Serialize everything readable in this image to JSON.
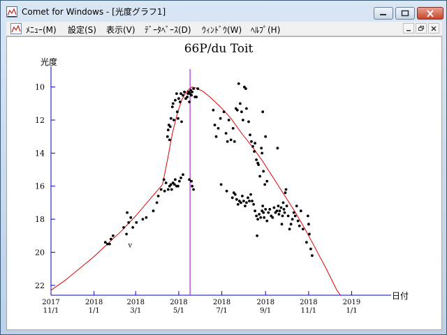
{
  "window": {
    "title": "Comet for Windows - [光度グラフ1]",
    "controls": {
      "minimize": "minimize",
      "maximize": "maximize",
      "close": "close"
    }
  },
  "menu": {
    "items": [
      {
        "label": "ﾒﾆｭｰ(M)"
      },
      {
        "label": "設定(S)"
      },
      {
        "label": "表示(V)"
      },
      {
        "label": "ﾃﾞｰﾀﾍﾞｰｽ(D)"
      },
      {
        "label": "ｳｨﾝﾄﾞｳ(W)"
      },
      {
        "label": "ﾍﾙﾌﾟ(H)"
      }
    ]
  },
  "colors": {
    "axis": "#0000c0",
    "curve": "#e00000",
    "marker_line": "#a000c0",
    "points": "#000000"
  },
  "chart_data": {
    "type": "scatter",
    "title": "66P/du Toit",
    "ylabel": "光度",
    "xlabel": "日付",
    "y_inverted": true,
    "ylim": [
      22.6,
      9.0
    ],
    "x_range_days": [
      0,
      470
    ],
    "x_ticks": [
      {
        "day": 0,
        "year": "2017",
        "date": "11/1"
      },
      {
        "day": 61,
        "year": "2018",
        "date": "1/1"
      },
      {
        "day": 120,
        "year": "2018",
        "date": "3/1"
      },
      {
        "day": 181,
        "year": "2018",
        "date": "5/1"
      },
      {
        "day": 242,
        "year": "2018",
        "date": "7/1"
      },
      {
        "day": 304,
        "year": "2018",
        "date": "9/1"
      },
      {
        "day": 365,
        "year": "2018",
        "date": "11/1"
      },
      {
        "day": 426,
        "year": "2019",
        "date": "1/1"
      }
    ],
    "y_ticks": [
      "10",
      "12",
      "14",
      "16",
      "18",
      "20",
      "22"
    ],
    "perihelion_day": 197,
    "annotation": {
      "text": "v",
      "x": 112,
      "y": 19.7
    },
    "curve": [
      [
        -10,
        22.7
      ],
      [
        0,
        22.3
      ],
      [
        20,
        21.7
      ],
      [
        40,
        21.0
      ],
      [
        60,
        20.3
      ],
      [
        80,
        19.5
      ],
      [
        100,
        18.7
      ],
      [
        120,
        17.8
      ],
      [
        140,
        16.8
      ],
      [
        150,
        16.3
      ],
      [
        158,
        15.9
      ],
      [
        165,
        14.4
      ],
      [
        172,
        12.8
      ],
      [
        179,
        11.6
      ],
      [
        185,
        10.8
      ],
      [
        190,
        10.4
      ],
      [
        195,
        10.15
      ],
      [
        200,
        10.0
      ],
      [
        205,
        10.05
      ],
      [
        215,
        10.25
      ],
      [
        225,
        10.6
      ],
      [
        240,
        11.2
      ],
      [
        255,
        11.9
      ],
      [
        270,
        12.8
      ],
      [
        285,
        13.6
      ],
      [
        300,
        14.5
      ],
      [
        315,
        15.5
      ],
      [
        330,
        16.5
      ],
      [
        345,
        17.5
      ],
      [
        360,
        18.6
      ],
      [
        375,
        19.8
      ],
      [
        390,
        21.0
      ],
      [
        405,
        22.3
      ],
      [
        412,
        22.7
      ]
    ],
    "points": [
      [
        77,
        19.4
      ],
      [
        80,
        19.5
      ],
      [
        83,
        19.5
      ],
      [
        85,
        19.2
      ],
      [
        88,
        19.0
      ],
      [
        103,
        18.5
      ],
      [
        108,
        17.6
      ],
      [
        107,
        18.9
      ],
      [
        110,
        18.2
      ],
      [
        113,
        17.9
      ],
      [
        116,
        18.5
      ],
      [
        121,
        18.2
      ],
      [
        130,
        18.0
      ],
      [
        135,
        17.9
      ],
      [
        145,
        17.5
      ],
      [
        150,
        17.0
      ],
      [
        152,
        16.6
      ],
      [
        156,
        16.2
      ],
      [
        160,
        15.6
      ],
      [
        161,
        16.3
      ],
      [
        163,
        15.8
      ],
      [
        165,
        13.0
      ],
      [
        166,
        12.6
      ],
      [
        167,
        12.3
      ],
      [
        168,
        13.2
      ],
      [
        169,
        12.4
      ],
      [
        170,
        11.9
      ],
      [
        172,
        11.2
      ],
      [
        173,
        11.0
      ],
      [
        174,
        12.0
      ],
      [
        176,
        10.8
      ],
      [
        178,
        10.4
      ],
      [
        179,
        11.5
      ],
      [
        180,
        11.9
      ],
      [
        181,
        10.7
      ],
      [
        183,
        10.9
      ],
      [
        184,
        10.4
      ],
      [
        185,
        12.1
      ],
      [
        187,
        10.5
      ],
      [
        189,
        10.3
      ],
      [
        191,
        10.7
      ],
      [
        193,
        10.6
      ],
      [
        195,
        10.3
      ],
      [
        197,
        10.4
      ],
      [
        198,
        10.2
      ],
      [
        199,
        10.5
      ],
      [
        200,
        10.3
      ],
      [
        202,
        10.1
      ],
      [
        204,
        10.6
      ],
      [
        206,
        10.6
      ],
      [
        208,
        10.1
      ],
      [
        196,
        10.9
      ],
      [
        194,
        10.4
      ],
      [
        166,
        16.2
      ],
      [
        168,
        16.0
      ],
      [
        170,
        15.9
      ],
      [
        171,
        16.2
      ],
      [
        173,
        15.8
      ],
      [
        175,
        15.9
      ],
      [
        176,
        15.6
      ],
      [
        178,
        16.0
      ],
      [
        180,
        16.0
      ],
      [
        182,
        15.7
      ],
      [
        184,
        15.5
      ],
      [
        187,
        15.3
      ],
      [
        196,
        15.6
      ],
      [
        199,
        15.7
      ],
      [
        200,
        16.0
      ],
      [
        202,
        16.2
      ],
      [
        230,
        11.4
      ],
      [
        232,
        12.3
      ],
      [
        234,
        13.0
      ],
      [
        237,
        12.5
      ],
      [
        240,
        11.9
      ],
      [
        245,
        11.5
      ],
      [
        248,
        12.8
      ],
      [
        250,
        13.3
      ],
      [
        252,
        12.0
      ],
      [
        255,
        13.2
      ],
      [
        258,
        12.5
      ],
      [
        260,
        13.3
      ],
      [
        262,
        11.3
      ],
      [
        264,
        11.4
      ],
      [
        266,
        9.8
      ],
      [
        268,
        11.0
      ],
      [
        270,
        11.5
      ],
      [
        272,
        12.0
      ],
      [
        274,
        10.0
      ],
      [
        276,
        10.1
      ],
      [
        277,
        11.3
      ],
      [
        280,
        12.1
      ],
      [
        282,
        12.9
      ],
      [
        284,
        13.3
      ],
      [
        286,
        13.6
      ],
      [
        288,
        13.9
      ],
      [
        289,
        13.4
      ],
      [
        291,
        14.4
      ],
      [
        293,
        14.6
      ],
      [
        294,
        14.7
      ],
      [
        296,
        15.4
      ],
      [
        298,
        13.7
      ],
      [
        299,
        14.0
      ],
      [
        300,
        11.5
      ],
      [
        301,
        15.1
      ],
      [
        303,
        15.9
      ],
      [
        304,
        13.0
      ],
      [
        306,
        15.7
      ],
      [
        241,
        15.9
      ],
      [
        249,
        16.3
      ],
      [
        257,
        16.7
      ],
      [
        259,
        16.4
      ],
      [
        261,
        16.5
      ],
      [
        263,
        16.8
      ],
      [
        265,
        17.1
      ],
      [
        267,
        16.9
      ],
      [
        269,
        17.0
      ],
      [
        271,
        16.6
      ],
      [
        273,
        16.9
      ],
      [
        275,
        17.2
      ],
      [
        277,
        17.0
      ],
      [
        279,
        16.7
      ],
      [
        281,
        16.9
      ],
      [
        283,
        16.5
      ],
      [
        285,
        16.9
      ],
      [
        287,
        17.1
      ],
      [
        289,
        17.5
      ],
      [
        291,
        17.8
      ],
      [
        292,
        19.0
      ],
      [
        293,
        18.0
      ],
      [
        295,
        17.7
      ],
      [
        297,
        17.9
      ],
      [
        299,
        17.5
      ],
      [
        300,
        17.2
      ],
      [
        301,
        17.6
      ],
      [
        302,
        17.9
      ],
      [
        304,
        17.4
      ],
      [
        306,
        18.1
      ],
      [
        308,
        17.6
      ],
      [
        310,
        17.4
      ],
      [
        312,
        17.8
      ],
      [
        314,
        17.9
      ],
      [
        316,
        17.3
      ],
      [
        318,
        17.6
      ],
      [
        320,
        17.5
      ],
      [
        321,
        13.7
      ],
      [
        322,
        17.2
      ],
      [
        323,
        17.7
      ],
      [
        324,
        17.5
      ],
      [
        326,
        17.3
      ],
      [
        327,
        18.3
      ],
      [
        328,
        17.8
      ],
      [
        329,
        17.0
      ],
      [
        330,
        17.4
      ],
      [
        331,
        17.6
      ],
      [
        332,
        16.4
      ],
      [
        333,
        16.2
      ],
      [
        334,
        17.2
      ],
      [
        336,
        17.8
      ],
      [
        338,
        18.6
      ],
      [
        340,
        18.3
      ],
      [
        342,
        18.0
      ],
      [
        344,
        17.6
      ],
      [
        346,
        17.8
      ],
      [
        348,
        17.2
      ],
      [
        350,
        18.1
      ],
      [
        352,
        18.4
      ],
      [
        354,
        17.5
      ],
      [
        357,
        18.6
      ],
      [
        362,
        19.4
      ],
      [
        364,
        17.8
      ],
      [
        365,
        18.3
      ],
      [
        366,
        18.9
      ],
      [
        368,
        19.8
      ],
      [
        370,
        20.2
      ]
    ]
  }
}
